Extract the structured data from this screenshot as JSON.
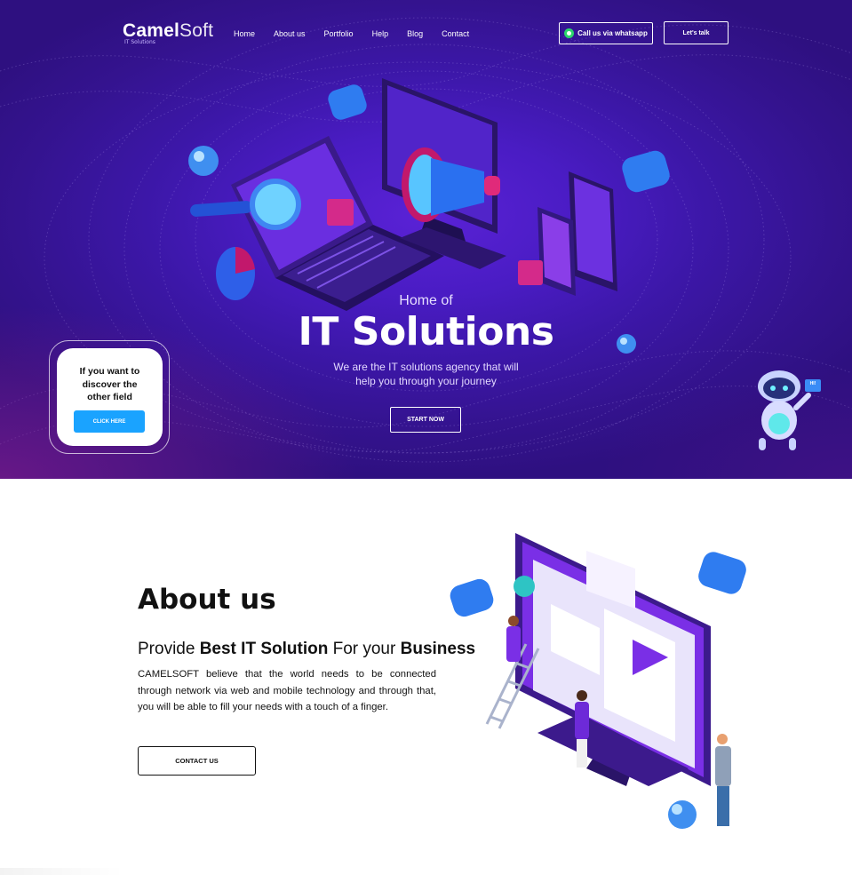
{
  "header": {
    "logo_main_bold": "Camel",
    "logo_main_light": "Soft",
    "logo_sub": "IT Solutions",
    "nav": [
      "Home",
      "About us",
      "Portfolio",
      "Help",
      "Blog",
      "Contact"
    ],
    "whatsapp_label": "Call us via whatsapp",
    "talk_label": "Let's talk"
  },
  "hero": {
    "pre_title": "Home of",
    "title": "IT Solutions",
    "subtitle_line1": "We are the IT solutions agency that will",
    "subtitle_line2": "help you through your journey",
    "start_label": "START NOW",
    "robot_bubble": "HI!"
  },
  "side_card": {
    "line1": "If you want to",
    "line2": "discover the",
    "line3": "other field",
    "button_label": "CLICK HERE"
  },
  "about": {
    "title": "About us",
    "sub_1": "Provide ",
    "sub_2": "Best IT Solution",
    "sub_3": " For your ",
    "sub_4": "Business",
    "body": "CAMELSOFT believe that the world needs to be connected through network via web and mobile technology and through that, you will be able to fill your needs with a touch of a finger.",
    "contact_label": "CONTACT US"
  },
  "colors": {
    "hero_bg": "#3c17a8",
    "accent_blue": "#1aa3ff",
    "whatsapp_green": "#2bd66b"
  }
}
